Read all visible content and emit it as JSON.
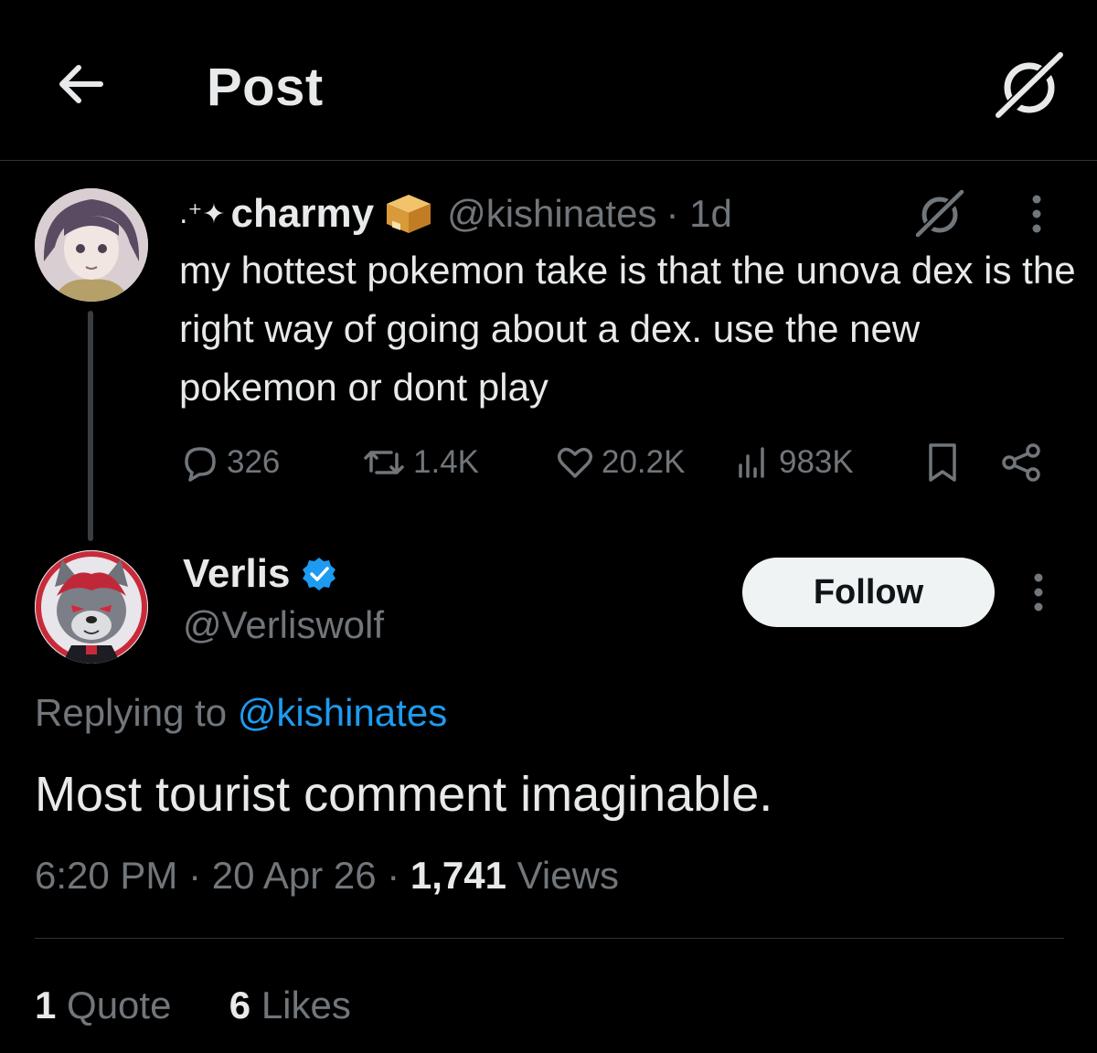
{
  "header": {
    "title": "Post",
    "back_icon": "arrow-left-icon",
    "grok_icon": "grok-icon"
  },
  "parent_post": {
    "sparkle": ".⁺✦",
    "display_name": "charmy",
    "name_emoji": "package-emoji",
    "handle": "@kishinates",
    "time": "· 1d",
    "text": "my hottest pokemon take is that the unova dex is the right way of going about a dex. use the new pokemon or dont play",
    "metrics": {
      "replies": "326",
      "reposts": "1.4K",
      "likes": "20.2K",
      "views": "983K"
    }
  },
  "main_post": {
    "display_name": "Verlis",
    "verified": true,
    "handle": "@Verliswolf",
    "follow_label": "Follow",
    "replying_prefix": "Replying to",
    "replying_handle": "@kishinates",
    "text": "Most tourist comment imaginable.",
    "time": "6:20 PM",
    "date": "20 Apr 26",
    "views_count": "1,741",
    "views_label": "Views",
    "quotes_count": "1",
    "quotes_label": "Quote",
    "likes_count": "6",
    "likes_label": "Likes"
  },
  "colors": {
    "background": "#000000",
    "text": "#e7e9ea",
    "muted": "#71767b",
    "accent": "#1d9bf0",
    "divider": "#2f3336"
  }
}
